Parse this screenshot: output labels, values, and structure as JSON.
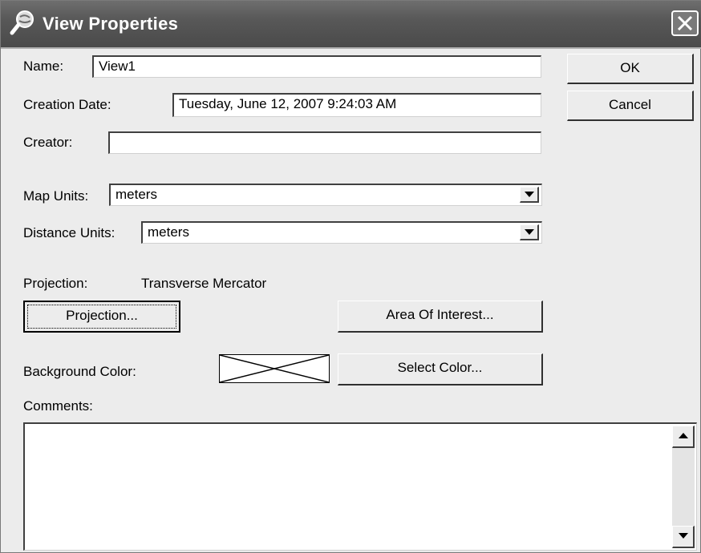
{
  "window": {
    "title": "View Properties",
    "icon": "magnifier-globe-icon",
    "close_icon": "close-icon"
  },
  "form": {
    "name_label": "Name:",
    "name_value": "View1",
    "creation_date_label": "Creation Date:",
    "creation_date_value": "Tuesday, June 12, 2007 9:24:03 AM",
    "creator_label": "Creator:",
    "creator_value": "",
    "map_units_label": "Map Units:",
    "map_units_value": "meters",
    "distance_units_label": "Distance Units:",
    "distance_units_value": "meters",
    "projection_label": "Projection:",
    "projection_value": "Transverse Mercator",
    "background_color_label": "Background Color:",
    "comments_label": "Comments:",
    "comments_value": ""
  },
  "buttons": {
    "ok": "OK",
    "cancel": "Cancel",
    "projection": "Projection...",
    "area_of_interest": "Area Of Interest...",
    "select_color": "Select Color..."
  },
  "colors": {
    "title_bar": "#585858",
    "dialog_bg": "#ececec",
    "background_color_swatch": "none"
  }
}
